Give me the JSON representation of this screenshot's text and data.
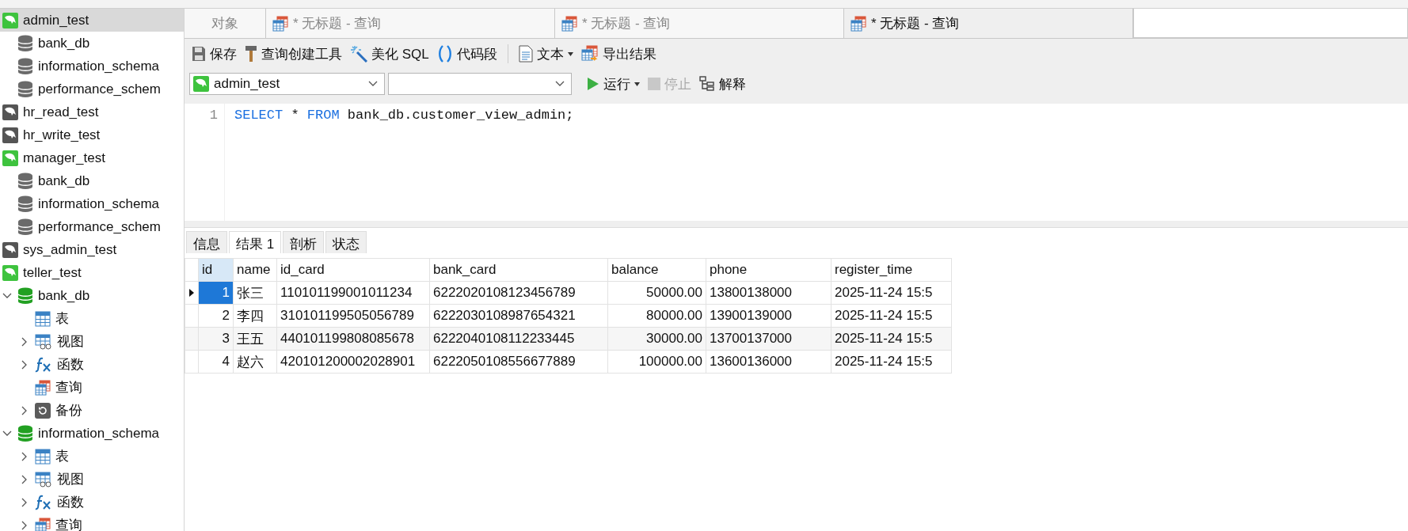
{
  "sidebar": {
    "tree": [
      {
        "kind": "connection",
        "label": "admin_test",
        "open": true,
        "selected": true,
        "children": [
          {
            "kind": "database",
            "label": "bank_db",
            "open": false,
            "selected": false
          },
          {
            "kind": "database",
            "label": "information_schema",
            "open": false,
            "selected": false
          },
          {
            "kind": "database",
            "label": "performance_schem",
            "open": false,
            "selected": false
          }
        ]
      },
      {
        "kind": "connection",
        "label": "hr_read_test",
        "open": false,
        "selected": false
      },
      {
        "kind": "connection",
        "label": "hr_write_test",
        "open": false,
        "selected": false
      },
      {
        "kind": "connection",
        "label": "manager_test",
        "open": true,
        "selected": false,
        "children": [
          {
            "kind": "database",
            "label": "bank_db",
            "open": false,
            "selected": false
          },
          {
            "kind": "database",
            "label": "information_schema",
            "open": false,
            "selected": false
          },
          {
            "kind": "database",
            "label": "performance_schem",
            "open": false,
            "selected": false
          }
        ]
      },
      {
        "kind": "connection",
        "label": "sys_admin_test",
        "open": false,
        "selected": false
      },
      {
        "kind": "connection",
        "label": "teller_test",
        "open": true,
        "selected": false,
        "children": [
          {
            "kind": "database",
            "label": "bank_db",
            "open": true,
            "expanded": true,
            "selected": false,
            "children": [
              {
                "kind": "table",
                "label": "表",
                "selected": false
              },
              {
                "kind": "view",
                "label": "视图",
                "expanded": false,
                "selected": false
              },
              {
                "kind": "function",
                "label": "函数",
                "expanded": false,
                "selected": false
              },
              {
                "kind": "query",
                "label": "查询",
                "selected": false
              },
              {
                "kind": "backup",
                "label": "备份",
                "expanded": false,
                "selected": false
              }
            ]
          },
          {
            "kind": "database",
            "label": "information_schema",
            "open": true,
            "expanded": true,
            "selected": false,
            "children": [
              {
                "kind": "table",
                "label": "表",
                "expanded": false,
                "selected": false
              },
              {
                "kind": "view",
                "label": "视图",
                "expanded": false,
                "selected": false
              },
              {
                "kind": "function",
                "label": "函数",
                "expanded": false,
                "selected": false
              },
              {
                "kind": "query",
                "label": "查询",
                "expanded": false,
                "selected": false
              }
            ]
          }
        ]
      }
    ]
  },
  "tabs": [
    {
      "kind": "objects",
      "label": "对象",
      "selected": false
    },
    {
      "kind": "query",
      "label": "* 无标题 - 查询",
      "selected": false
    },
    {
      "kind": "query",
      "label": "* 无标题 - 查询",
      "selected": false
    },
    {
      "kind": "query",
      "label": "* 无标题 - 查询",
      "selected": true
    }
  ],
  "toolbar": [
    {
      "kind": "save",
      "label": "保存"
    },
    {
      "kind": "builder",
      "label": "查询创建工具"
    },
    {
      "kind": "beautify",
      "label": "美化 SQL"
    },
    {
      "kind": "snippet",
      "label": "代码段"
    },
    {
      "kind": "separator"
    },
    {
      "kind": "text",
      "label": "文本",
      "dropdown": true
    },
    {
      "kind": "export",
      "label": "导出结果"
    }
  ],
  "connection_select": {
    "value": "admin_test"
  },
  "run_bar": [
    {
      "kind": "run",
      "label": "运行",
      "dropdown": true,
      "disabled": false
    },
    {
      "kind": "stop",
      "label": "停止",
      "disabled": true
    },
    {
      "kind": "explain",
      "label": "解释",
      "disabled": false
    }
  ],
  "editor": {
    "lines": [
      {
        "number": "1",
        "tokens": [
          {
            "text": "SELECT",
            "kind": "keyword"
          },
          {
            "text": " * ",
            "kind": "plain"
          },
          {
            "text": "FROM",
            "kind": "keyword"
          },
          {
            "text": " bank_db.customer_view_admin;",
            "kind": "plain"
          }
        ]
      }
    ]
  },
  "result_tabs": [
    {
      "label": "信息",
      "selected": false
    },
    {
      "label": "结果 1",
      "selected": true
    },
    {
      "label": "剖析",
      "selected": false
    },
    {
      "label": "状态",
      "selected": false
    }
  ],
  "table": {
    "columns": [
      {
        "label": "id",
        "kind": "number",
        "selected": true
      },
      {
        "label": "name",
        "kind": "text",
        "selected": false
      },
      {
        "label": "id_card",
        "kind": "text",
        "selected": false
      },
      {
        "label": "bank_card",
        "kind": "text",
        "selected": false
      },
      {
        "label": "balance",
        "kind": "number",
        "selected": false
      },
      {
        "label": "phone",
        "kind": "text",
        "selected": false
      },
      {
        "label": "register_time",
        "kind": "text",
        "selected": false
      }
    ],
    "rows": [
      {
        "selected": true,
        "cells": [
          "1",
          "张三",
          "110101199001011234",
          "6222020108123456789",
          "50000.00",
          "13800138000",
          "2025-11-24 15:5"
        ]
      },
      {
        "selected": false,
        "cells": [
          "2",
          "李四",
          "310101199505056789",
          "6222030108987654321",
          "80000.00",
          "13900139000",
          "2025-11-24 15:5"
        ]
      },
      {
        "selected": false,
        "cells": [
          "3",
          "王五",
          "440101199808085678",
          "6222040108112233445",
          "30000.00",
          "13700137000",
          "2025-11-24 15:5"
        ]
      },
      {
        "selected": false,
        "cells": [
          "4",
          "赵六",
          "420101200002028901",
          "6222050108556677889",
          "100000.00",
          "13600136000",
          "2025-11-24 15:5"
        ]
      }
    ]
  }
}
